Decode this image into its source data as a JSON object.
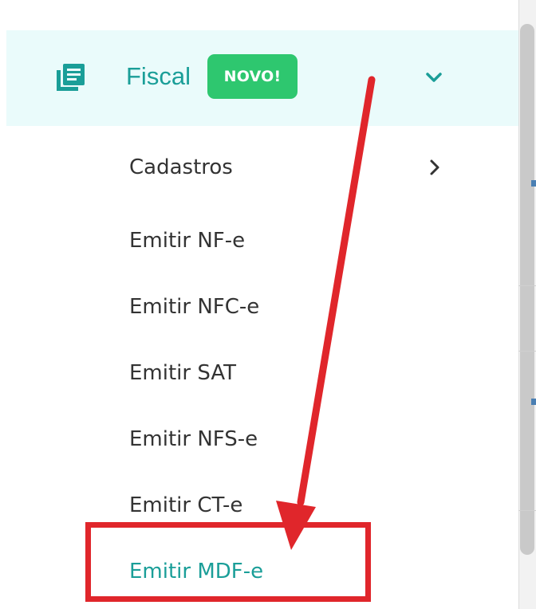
{
  "menu": {
    "section_label": "Fiscal",
    "badge": "NOVO!",
    "items": [
      {
        "label": "Cadastros"
      },
      {
        "label": "Emitir NF-e"
      },
      {
        "label": "Emitir NFC-e"
      },
      {
        "label": "Emitir SAT"
      },
      {
        "label": "Emitir NFS-e"
      },
      {
        "label": "Emitir CT-e"
      },
      {
        "label": "Emitir MDF-e"
      }
    ]
  },
  "icons": {
    "section": "document-list-icon",
    "expand": "chevron-down-icon",
    "submenu": "chevron-right-icon"
  },
  "colors": {
    "accent": "#1a9e98",
    "header_bg": "#eafbfb",
    "badge": "#2ec76f",
    "annotation": "#e0262b",
    "text": "#333333"
  }
}
